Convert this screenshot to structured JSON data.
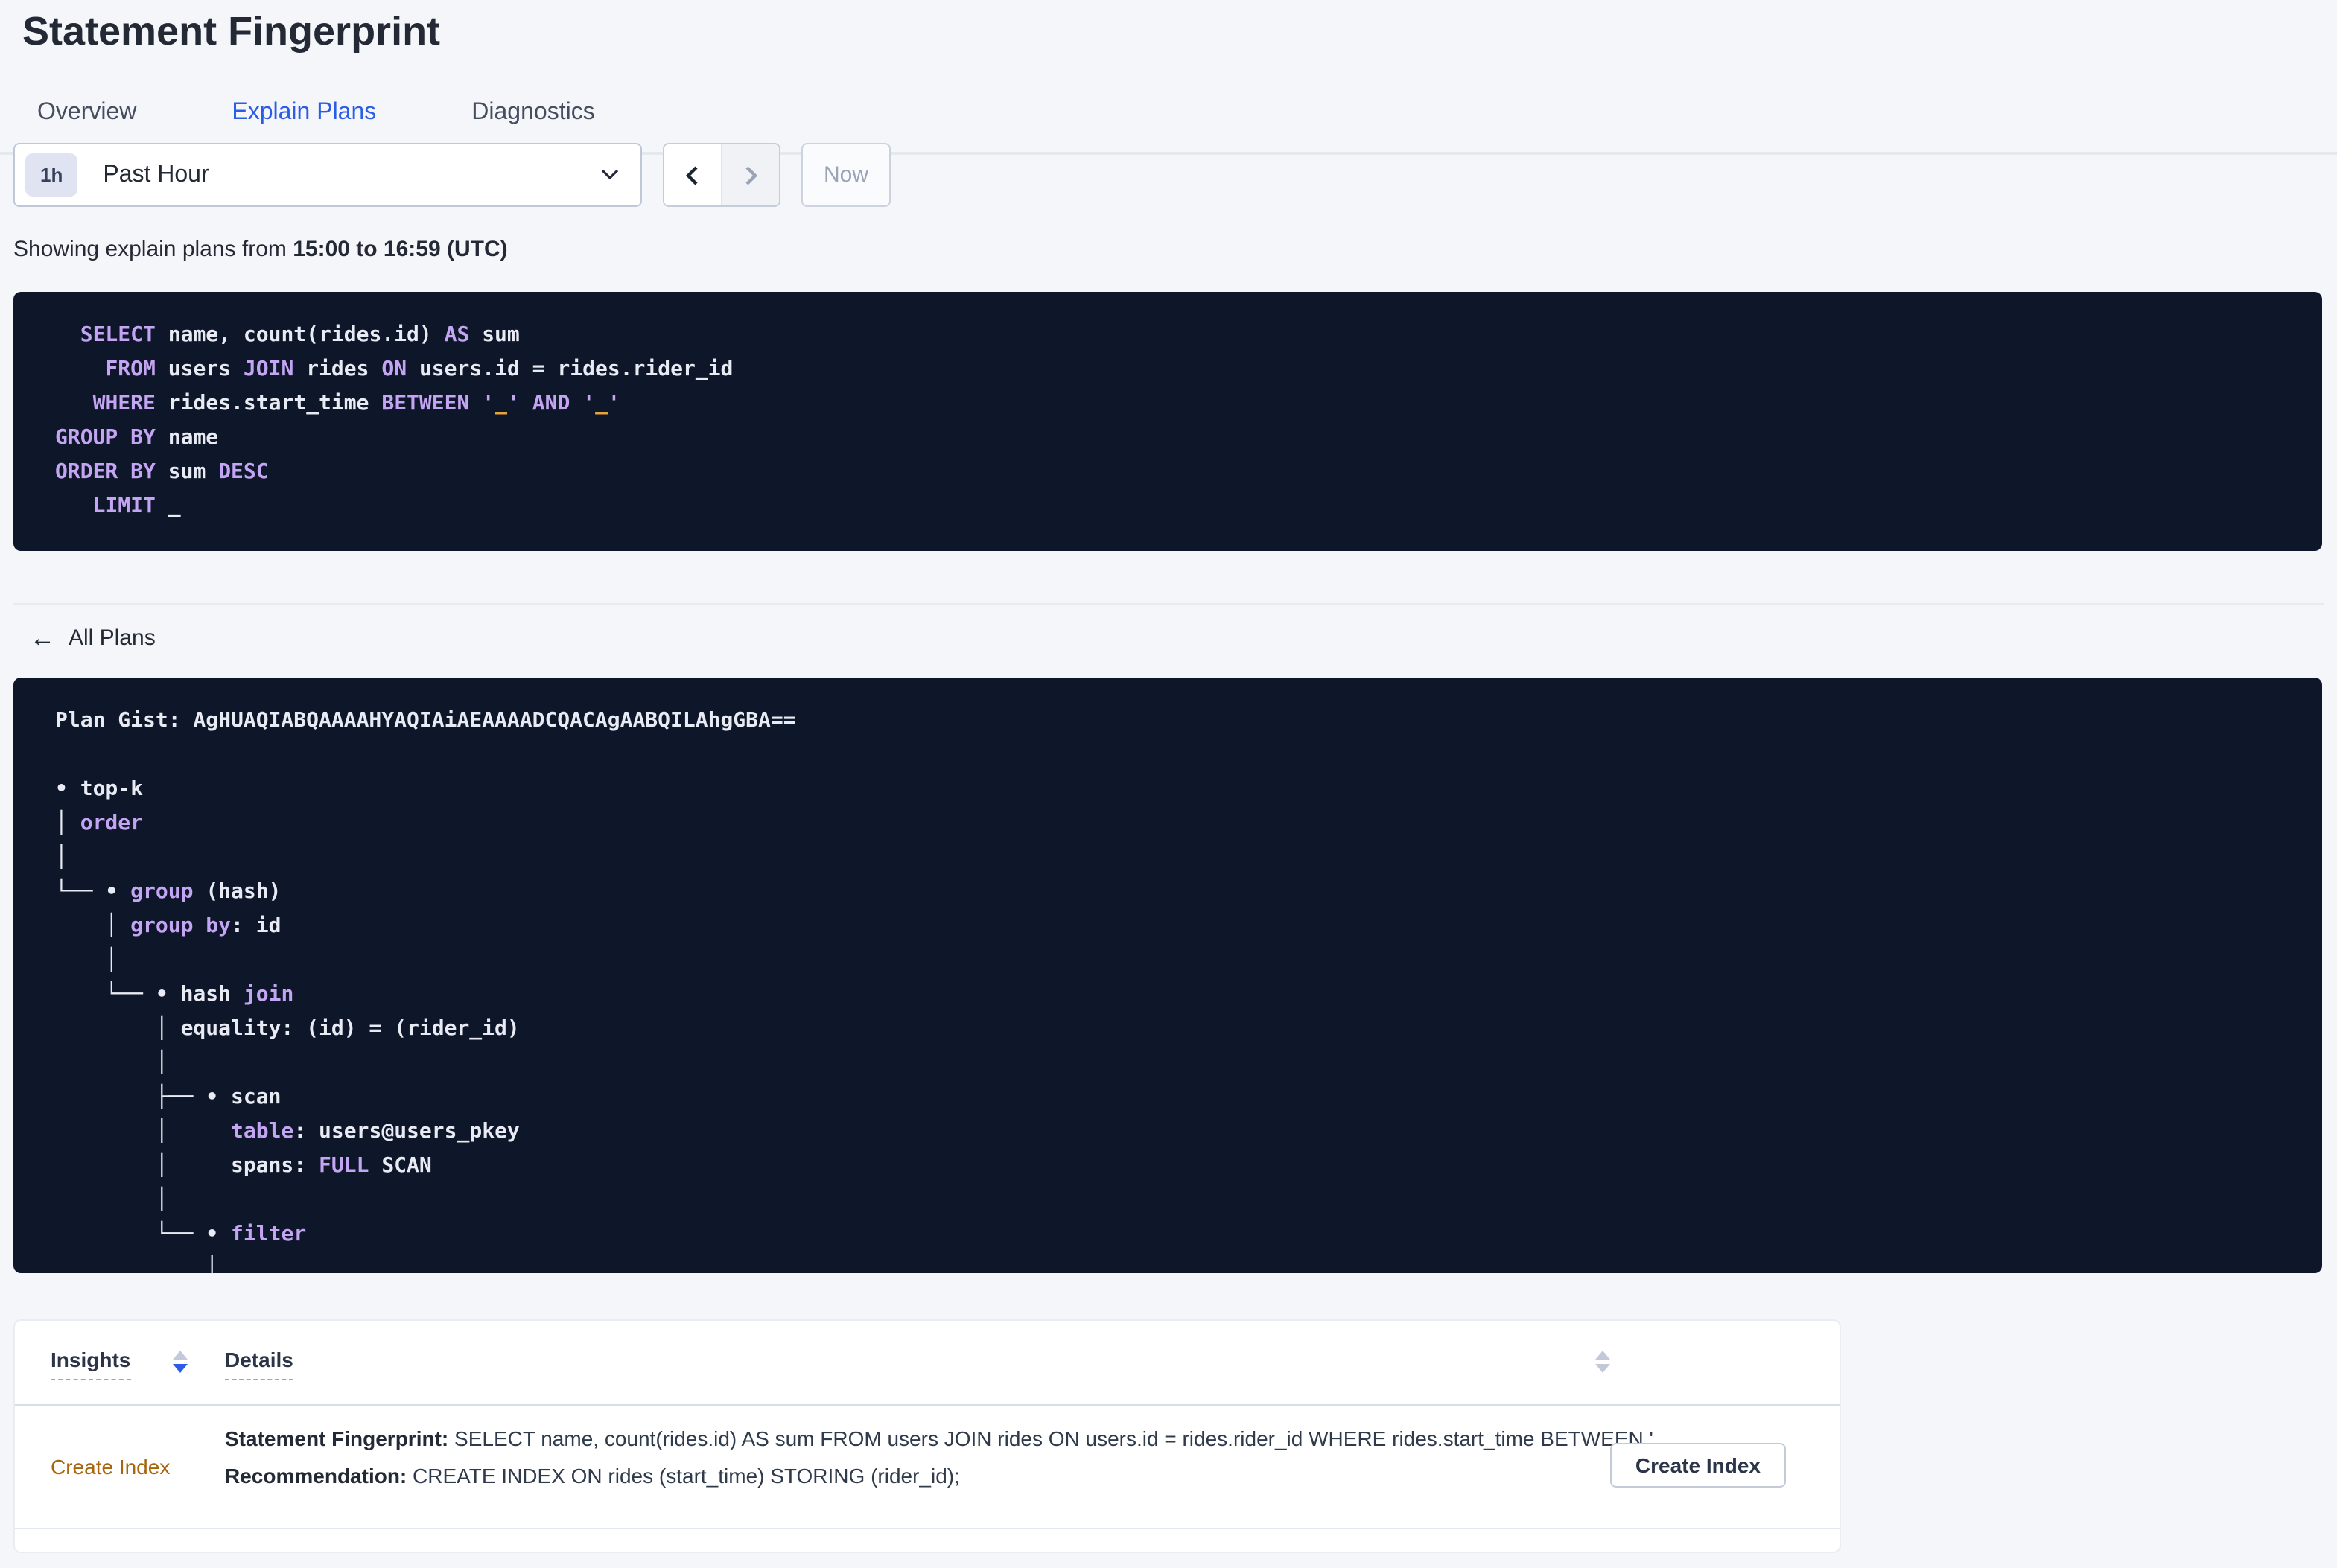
{
  "page": {
    "title": "Statement Fingerprint"
  },
  "tabs": [
    {
      "label": "Overview",
      "active": false
    },
    {
      "label": "Explain Plans",
      "active": true
    },
    {
      "label": "Diagnostics",
      "active": false
    }
  ],
  "time_picker": {
    "badge": "1h",
    "selected": "Past Hour",
    "now_label": "Now",
    "icons": [
      "chevron-down-icon",
      "chevron-left-icon",
      "chevron-right-icon"
    ]
  },
  "showing": {
    "prefix": "Showing explain plans from ",
    "range": "15:00 to 16:59 (UTC)"
  },
  "colors": {
    "accent_blue": "#2b5ce6",
    "code_background": "#0e1729",
    "code_keyword": "#c4a5f3",
    "code_plain": "#e8ebf3",
    "code_literal": "#e8a33c",
    "insight_orange": "#a8650c"
  },
  "sql": {
    "lines": [
      [
        [
          "pl",
          "  "
        ],
        [
          "kw",
          "SELECT"
        ],
        [
          "pl",
          " name, count(rides.id) "
        ],
        [
          "kw",
          "AS"
        ],
        [
          "pl",
          " sum"
        ]
      ],
      [
        [
          "pl",
          "    "
        ],
        [
          "kw",
          "FROM"
        ],
        [
          "pl",
          " users "
        ],
        [
          "kw",
          "JOIN"
        ],
        [
          "pl",
          " rides "
        ],
        [
          "kw",
          "ON"
        ],
        [
          "pl",
          " users.id = rides.rider_id"
        ]
      ],
      [
        [
          "pl",
          "   "
        ],
        [
          "kw",
          "WHERE"
        ],
        [
          "pl",
          " rides.start_time "
        ],
        [
          "kw",
          "BETWEEN"
        ],
        [
          "pl",
          " "
        ],
        [
          "str",
          "'"
        ],
        [
          "num",
          "_"
        ],
        [
          "str",
          "'"
        ],
        [
          "pl",
          " "
        ],
        [
          "kw",
          "AND"
        ],
        [
          "pl",
          " "
        ],
        [
          "str",
          "'"
        ],
        [
          "num",
          "_"
        ],
        [
          "str",
          "'"
        ]
      ],
      [
        [
          "kw",
          "GROUP BY"
        ],
        [
          "pl",
          " name"
        ]
      ],
      [
        [
          "kw",
          "ORDER BY"
        ],
        [
          "pl",
          " sum "
        ],
        [
          "kw",
          "DESC"
        ]
      ],
      [
        [
          "pl",
          "   "
        ],
        [
          "kw",
          "LIMIT"
        ],
        [
          "pl",
          " _"
        ]
      ]
    ]
  },
  "all_plans": {
    "label": "All Plans",
    "icon": "back-arrow-icon"
  },
  "plan": {
    "gist_label": "Plan Gist:",
    "gist": "AgHUAQIABQAAAAHYAQIAiAEAAAADCQACAgAABQILAhgGBA==",
    "tree_lines": [
      [
        [
          "pl",
          "Plan Gist: AgHUAQIABQAAAAHYAQIAiAEAAAADCQACAgAABQILAhgGBA=="
        ]
      ],
      [],
      [
        [
          "pl",
          "• top-k"
        ]
      ],
      [
        [
          "pl",
          "│ "
        ],
        [
          "kw",
          "order"
        ]
      ],
      [
        [
          "pl",
          "│"
        ]
      ],
      [
        [
          "pl",
          "└── • "
        ],
        [
          "kw",
          "group"
        ],
        [
          "pl",
          " (hash)"
        ]
      ],
      [
        [
          "pl",
          "    │ "
        ],
        [
          "kw",
          "group by"
        ],
        [
          "pl",
          ": id"
        ]
      ],
      [
        [
          "pl",
          "    │"
        ]
      ],
      [
        [
          "pl",
          "    └── • hash "
        ],
        [
          "kw",
          "join"
        ]
      ],
      [
        [
          "pl",
          "        │ equality: (id) = (rider_id)"
        ]
      ],
      [
        [
          "pl",
          "        │"
        ]
      ],
      [
        [
          "pl",
          "        ├── • scan"
        ]
      ],
      [
        [
          "pl",
          "        │     "
        ],
        [
          "kw",
          "table"
        ],
        [
          "pl",
          ": users@users_pkey"
        ]
      ],
      [
        [
          "pl",
          "        │     spans: "
        ],
        [
          "kw",
          "FULL"
        ],
        [
          "pl",
          " SCAN"
        ]
      ],
      [
        [
          "pl",
          "        │"
        ]
      ],
      [
        [
          "pl",
          "        └── • "
        ],
        [
          "kw",
          "filter"
        ]
      ],
      [
        [
          "pl",
          "            │"
        ]
      ]
    ]
  },
  "table": {
    "columns": [
      {
        "label": "Insights",
        "sort": "desc"
      },
      {
        "label": "Details",
        "sort": "none"
      }
    ],
    "rows": [
      {
        "insight": "Create Index",
        "details": [
          {
            "label": "Statement Fingerprint:",
            "text": " SELECT name, count(rides.id) AS sum FROM users JOIN rides ON users.id = rides.rider_id WHERE rides.start_time BETWEEN '_…"
          },
          {
            "label": "Recommendation:",
            "text": " CREATE INDEX ON rides (start_time) STORING (rider_id);"
          }
        ],
        "action_label": "Create Index"
      }
    ]
  }
}
